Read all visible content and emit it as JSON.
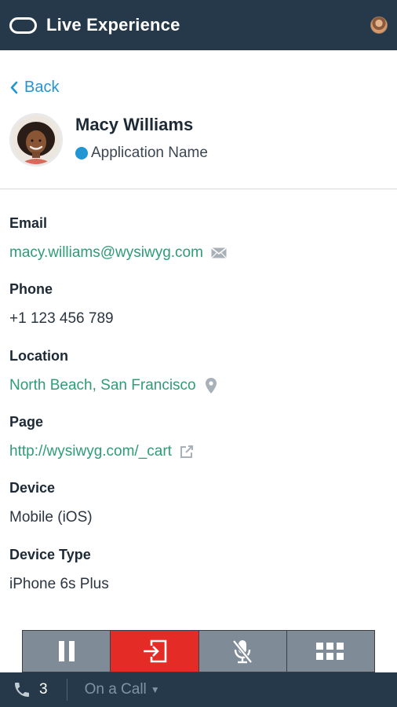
{
  "header": {
    "title": "Live Experience",
    "logo_icon": "oracle-ring-icon",
    "avatar_icon": "user-avatar"
  },
  "nav": {
    "back_label": "Back"
  },
  "profile": {
    "name": "Macy Williams",
    "app_name": "Application Name",
    "status_color": "#2196d3"
  },
  "details": {
    "email": {
      "label": "Email",
      "value": "macy.williams@wysiwyg.com",
      "icon": "mail-icon"
    },
    "phone": {
      "label": "Phone",
      "value": "+1 123 456 789"
    },
    "location": {
      "label": "Location",
      "value": "North Beach, San Francisco",
      "icon": "map-pin-icon"
    },
    "page": {
      "label": "Page",
      "value": "http://wysiwyg.com/_cart",
      "icon": "external-link-icon"
    },
    "device": {
      "label": "Device",
      "value": "Mobile (iOS)"
    },
    "device_type": {
      "label": "Device Type",
      "value": "iPhone 6s Plus"
    }
  },
  "call_controls": {
    "buttons": [
      "pause-icon",
      "end-call-icon",
      "mute-mic-icon",
      "keypad-icon"
    ],
    "end_color": "#e52b26",
    "button_color": "#7f8b96"
  },
  "status_bar": {
    "call_count": "3",
    "call_state": "On a Call",
    "bg_color": "#26394a"
  }
}
